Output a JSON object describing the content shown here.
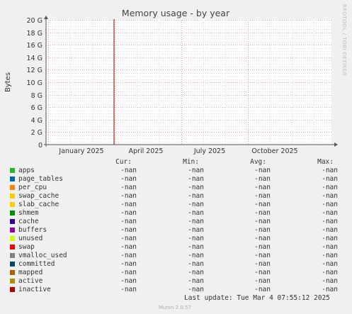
{
  "chart_data": {
    "type": "line",
    "title": "Memory usage - by year",
    "ylabel": "Bytes",
    "yticks": [
      "0",
      "2 G",
      "4 G",
      "6 G",
      "8 G",
      "10 G",
      "12 G",
      "14 G",
      "16 G",
      "18 G",
      "20 G"
    ],
    "ylim": [
      0,
      20
    ],
    "xticks": [
      "January 2025",
      "April 2025",
      "July 2025",
      "October 2025"
    ],
    "grid": true,
    "series": []
  },
  "side_label": "RRDTOOL / TOBI OETIKER",
  "legend": {
    "headers": {
      "cur": "Cur:",
      "min": "Min:",
      "avg": "Avg:",
      "max": "Max:"
    },
    "items": [
      {
        "name": "apps",
        "color": "#22bb22",
        "cur": "-nan",
        "min": "-nan",
        "avg": "-nan",
        "max": "-nan"
      },
      {
        "name": "page_tables",
        "color": "#0066b3",
        "cur": "-nan",
        "min": "-nan",
        "avg": "-nan",
        "max": "-nan"
      },
      {
        "name": "per_cpu",
        "color": "#ff8000",
        "cur": "-nan",
        "min": "-nan",
        "avg": "-nan",
        "max": "-nan"
      },
      {
        "name": "swap_cache",
        "color": "#ffcc00",
        "cur": "-nan",
        "min": "-nan",
        "avg": "-nan",
        "max": "-nan"
      },
      {
        "name": "slab_cache",
        "color": "#ffcc00",
        "cur": "-nan",
        "min": "-nan",
        "avg": "-nan",
        "max": "-nan"
      },
      {
        "name": "shmem",
        "color": "#008f00",
        "cur": "-nan",
        "min": "-nan",
        "avg": "-nan",
        "max": "-nan"
      },
      {
        "name": "cache",
        "color": "#330099",
        "cur": "-nan",
        "min": "-nan",
        "avg": "-nan",
        "max": "-nan"
      },
      {
        "name": "buffers",
        "color": "#990099",
        "cur": "-nan",
        "min": "-nan",
        "avg": "-nan",
        "max": "-nan"
      },
      {
        "name": "unused",
        "color": "#ccff00",
        "cur": "-nan",
        "min": "-nan",
        "avg": "-nan",
        "max": "-nan"
      },
      {
        "name": "swap",
        "color": "#ff0000",
        "cur": "-nan",
        "min": "-nan",
        "avg": "-nan",
        "max": "-nan"
      },
      {
        "name": "vmalloc_used",
        "color": "#808080",
        "cur": "-nan",
        "min": "-nan",
        "avg": "-nan",
        "max": "-nan"
      },
      {
        "name": "committed",
        "color": "#004d66",
        "cur": "-nan",
        "min": "-nan",
        "avg": "-nan",
        "max": "-nan"
      },
      {
        "name": "mapped",
        "color": "#b35a00",
        "cur": "-nan",
        "min": "-nan",
        "avg": "-nan",
        "max": "-nan"
      },
      {
        "name": "active",
        "color": "#b38f00",
        "cur": "-nan",
        "min": "-nan",
        "avg": "-nan",
        "max": "-nan"
      },
      {
        "name": "inactive",
        "color": "#b30000",
        "cur": "-nan",
        "min": "-nan",
        "avg": "-nan",
        "max": "-nan"
      }
    ]
  },
  "footer": {
    "last_update": "Last update: Tue Mar  4 07:55:12 2025",
    "munin": "Munin 2.0.57"
  },
  "colors": {
    "background": "#f0f0f0",
    "plot_bg": "#ffffff",
    "grid_major": "#e8a0a0",
    "grid_minor": "#e0e0e0",
    "now_line": "#800000"
  }
}
